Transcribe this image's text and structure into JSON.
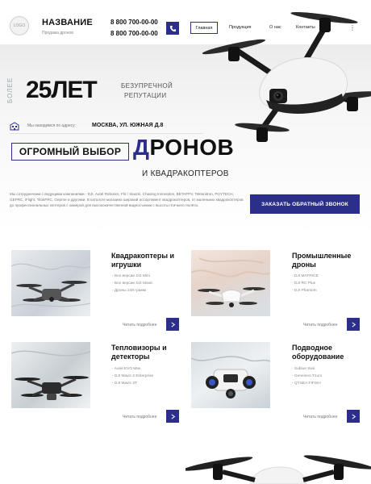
{
  "header": {
    "logo_text": "LOGO",
    "brand_title": "НАЗВАНИЕ",
    "brand_subtitle": "Продажа дронов",
    "phones": [
      "8 800 700-00-00",
      "8 800 700-00-00"
    ],
    "nav": [
      "Главная",
      "Продукция",
      "О нас",
      "Контакты"
    ],
    "more": "⋮"
  },
  "hero": {
    "more_vertical": "БОЛЕЕ",
    "years": "25ЛЕТ",
    "reputation_line1": "БЕЗУПРЕЧНОЙ",
    "reputation_line2": "РЕПУТАЦИИ",
    "address_label": "Мы находимся по адресу:",
    "address_value": "МОСКВА, УЛ. ЮЖНАЯ Д.8",
    "big_choice": "ОГРОМНЫЙ ВЫБОР",
    "drones_first": "Д",
    "drones_rest": "РОНОВ",
    "quadro": "И КВАДРАКОПТЕРОВ",
    "intro": "Мы сотрудничаем с ведущими компаниями - DJI, Autel Robotics, Flir / Xiaomi, Chasing Innovation, BETAFPV, Tektonitron, PGYTECH, GEPRC, iFlight, TitokFRC, Geprne и другими. В каталоге магазина широкий ассортимент квадрокоптеров, от маленьких квадрокоптеров до профессиональных коптеров с камерой для высококачественной видеосъемки с высоты птичьего полёта.",
    "cta": "ЗАКАЗАТЬ ОБРАТНЫЙ ЗВОНОК"
  },
  "categories": [
    {
      "title": "Квадракоптеры и игрушки",
      "items": [
        "- Все версии DJI Mini",
        "- Все версии DJI Mavic",
        "- Дроны 249 грамм"
      ],
      "link": "Читать подробнее"
    },
    {
      "title": "Промышленные дроны",
      "items": [
        "- DJI MATRICE",
        "- DJI RC Plus",
        "- DJI Phantom"
      ],
      "link": "Читать подробнее"
    },
    {
      "title": "Тепловизоры и детекторы",
      "items": [
        "- Autel EVO Max",
        "- DJI Mavic 2 Enterprise",
        "- DJI Mavic 3T"
      ],
      "link": "Читать подробнее"
    },
    {
      "title": "Подводное оборудование",
      "items": [
        "- Sublue Swii",
        "- Geneinno T1um",
        "- QYSEA FIFISH"
      ],
      "link": "Читать подробнее"
    }
  ],
  "colors": {
    "accent": "#2b2f8a"
  }
}
